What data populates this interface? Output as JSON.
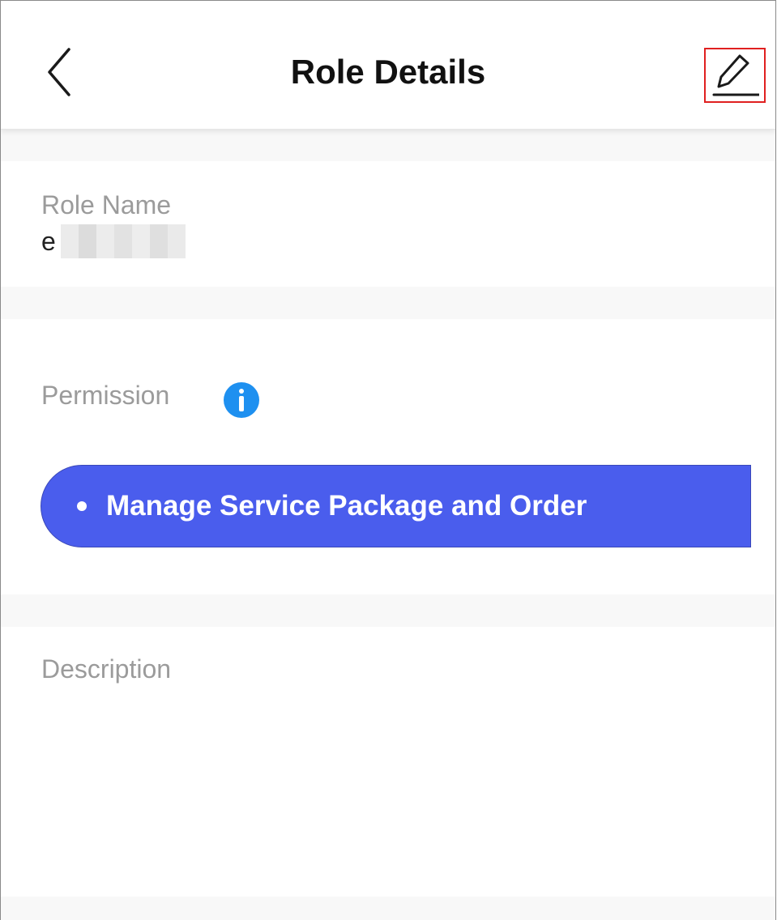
{
  "header": {
    "title": "Role Details",
    "back_icon": "chevron-left-icon",
    "edit_icon": "pencil-icon"
  },
  "role_name": {
    "label": "Role Name",
    "value_visible": "e",
    "value_redacted": true
  },
  "permission": {
    "label": "Permission",
    "info_icon": "info-icon",
    "items": [
      {
        "label": "Manage Service Package and Order"
      }
    ]
  },
  "description": {
    "label": "Description",
    "value": ""
  },
  "colors": {
    "accent": "#4a5ded",
    "info": "#1e90f0",
    "highlight_border": "#e02020",
    "label_gray": "#9b9b9b",
    "section_gap": "#f8f8f8"
  }
}
